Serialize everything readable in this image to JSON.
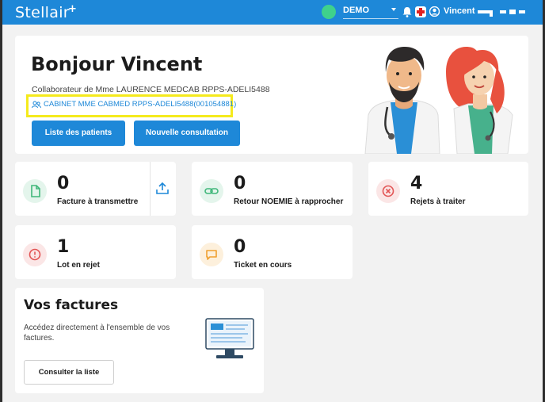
{
  "header": {
    "brand": "Stellair",
    "brand_mark": "+",
    "environment": "DEMO",
    "user_name": "Vincent",
    "colors": {
      "bar": "#1e88d8",
      "status": "#3fd18c"
    }
  },
  "welcome": {
    "greeting": "Bonjour Vincent",
    "collaborator": "Collaborateur de Mme LAURENCE MEDCAB RPPS-ADELI5488",
    "cabinet": "CABINET MME CABMED RPPS-ADELI5488(001054881)",
    "buttons": {
      "patients": "Liste des patients",
      "consultation": "Nouvelle consultation"
    }
  },
  "stats": [
    {
      "value": "0",
      "label": "Facture à transmettre",
      "icon": "document-icon",
      "color": "#3fb77a"
    },
    {
      "value": "0",
      "label": "Retour NOEMIE à rapprocher",
      "icon": "link-icon",
      "color": "#3fb77a"
    },
    {
      "value": "4",
      "label": "Rejets à traiter",
      "icon": "x-circle-icon",
      "color": "#e25555"
    },
    {
      "value": "1",
      "label": "Lot en rejet",
      "icon": "alert-circle-icon",
      "color": "#e25555"
    },
    {
      "value": "0",
      "label": "Ticket en cours",
      "icon": "message-icon",
      "color": "#f0a030"
    }
  ],
  "factures": {
    "title": "Vos factures",
    "description": "Accédez directement à l'ensemble de vos factures.",
    "button": "Consulter la liste"
  }
}
